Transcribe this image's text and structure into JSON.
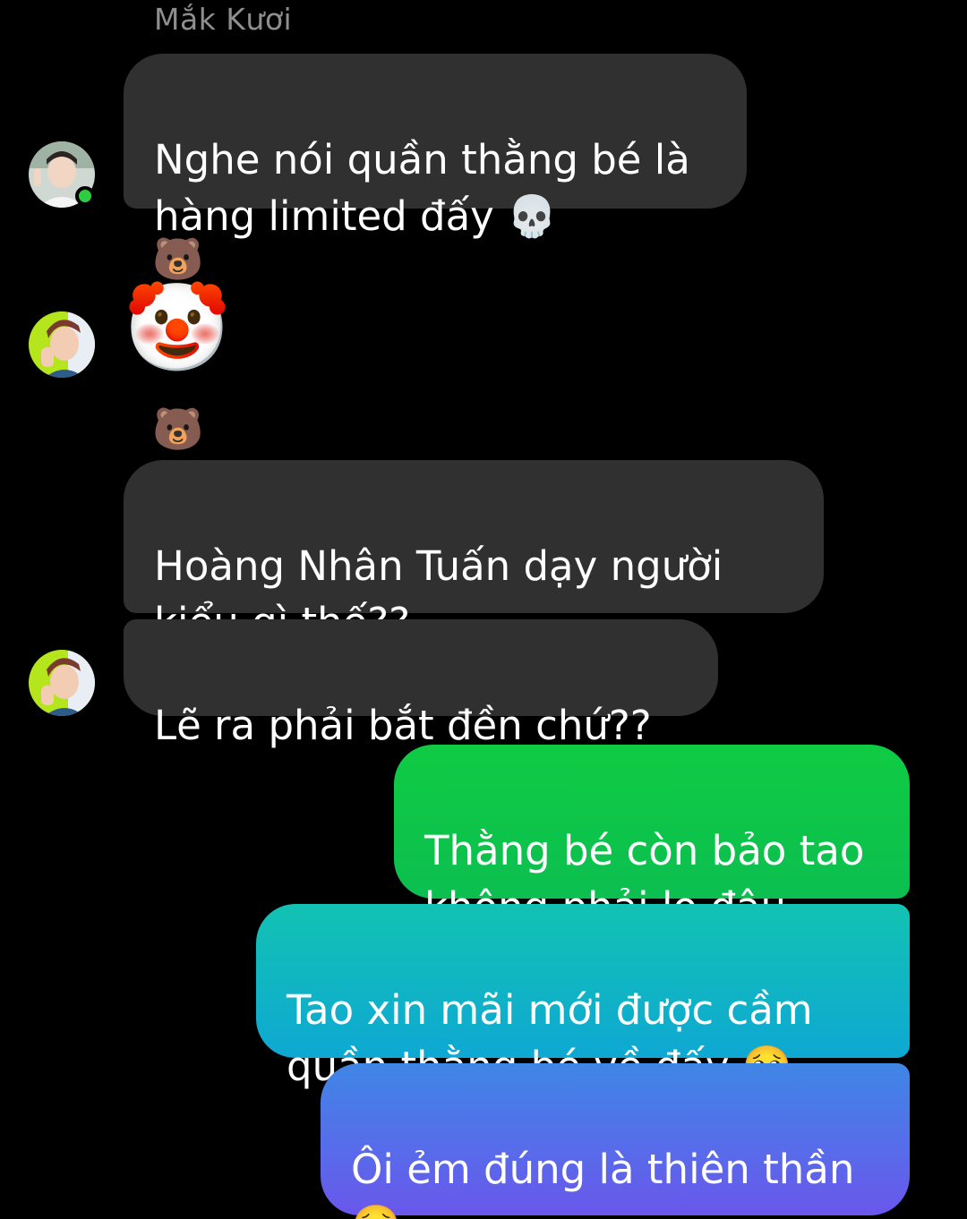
{
  "thread": {
    "sender_name": "Mắk Kươi",
    "messages": [
      {
        "text": "Nghe nói quần thằng bé là\nhàng limited đấy 💀"
      },
      {
        "reaction": "🐻",
        "text": "🤡"
      },
      {
        "reaction": "🐻",
        "text": "Hoàng Nhân Tuấn dạy người\nkiểu gì thế??"
      },
      {
        "text": "Lẽ ra phải bắt đền chứ??"
      },
      {
        "text": "Thằng bé còn bảo tao\nkhông phải lo đâu"
      },
      {
        "text": "Tao xin mãi mới được cầm\nquần thằng bé về đấy 🥺"
      },
      {
        "text": "Ôi ẻm đúng là thiên thần\n🥺"
      }
    ]
  },
  "colors": {
    "incoming_bubble": "#303030",
    "outgoing_gradient": [
      "#0dc63a",
      "#13b6c4",
      "#6b55ec"
    ],
    "online_indicator": "#2ecc40"
  }
}
